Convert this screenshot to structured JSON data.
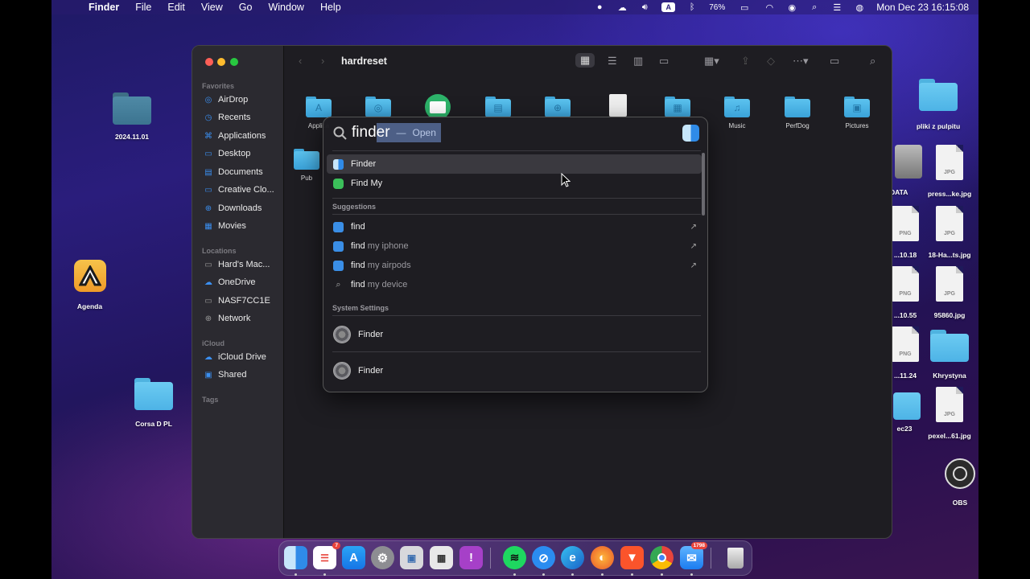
{
  "menubar": {
    "app": "Finder",
    "items": [
      "File",
      "Edit",
      "View",
      "Go",
      "Window",
      "Help"
    ],
    "battery": "76%",
    "datetime": "Mon Dec 23  16:15:08",
    "input_source": "A"
  },
  "desktop": {
    "left": [
      {
        "label": "2024.11.01",
        "kind": "folder-dark"
      },
      {
        "label": "Agenda",
        "kind": "app"
      },
      {
        "label": "Corsa D PL",
        "kind": "folder"
      }
    ],
    "right": [
      {
        "label": "pliki z pulpitu",
        "kind": "folder"
      },
      {
        "label": "DATA",
        "kind": "disk"
      },
      {
        "label": "press...ke.jpg",
        "kind": "file",
        "ext": "JPG"
      },
      {
        "label": "...10.18",
        "kind": "file",
        "ext": "PNG"
      },
      {
        "label": "18-Ha...ts.jpg",
        "kind": "file",
        "ext": "JPG"
      },
      {
        "label": "...10.55",
        "kind": "file",
        "ext": "PNG"
      },
      {
        "label": "95860.jpg",
        "kind": "file",
        "ext": "JPG"
      },
      {
        "label": "...11.24",
        "kind": "file",
        "ext": "PNG"
      },
      {
        "label": "Khrystyna",
        "kind": "folder"
      },
      {
        "label": "ec23",
        "kind": "folder"
      },
      {
        "label": "pexel...61.jpg",
        "kind": "file",
        "ext": "JPG"
      },
      {
        "label": "OBS",
        "kind": "app"
      }
    ]
  },
  "finder": {
    "title": "hardreset",
    "sidebar": {
      "favorites_header": "Favorites",
      "favorites": [
        "AirDrop",
        "Recents",
        "Applications",
        "Desktop",
        "Documents",
        "Creative Clo...",
        "Downloads",
        "Movies"
      ],
      "locations_header": "Locations",
      "locations": [
        "Hard's Mac...",
        "OneDrive",
        "NASF7CC1E",
        "Network"
      ],
      "icloud_header": "iCloud",
      "icloud": [
        "iCloud Drive",
        "Shared"
      ],
      "tags_header": "Tags"
    },
    "items": [
      "Applica",
      "",
      "",
      "",
      "",
      "",
      "",
      "Music",
      "PerfDog",
      "Pictures",
      "Pub"
    ]
  },
  "spotlight": {
    "typed": "find",
    "completion": "er",
    "hint_sep": "—",
    "hint": "Open",
    "top_hits": [
      "Finder",
      "Find My"
    ],
    "suggestions_header": "Suggestions",
    "suggestions": [
      {
        "bold": "find",
        "rest": ""
      },
      {
        "bold": "find",
        "rest": " my iphone"
      },
      {
        "bold": "find",
        "rest": " my airpods"
      },
      {
        "bold": "find",
        "rest": " my device"
      }
    ],
    "settings_header": "System Settings",
    "settings": [
      "Finder",
      "Finder"
    ]
  },
  "dock": {
    "reminders_badge": "7",
    "mail_badge": "1798"
  }
}
